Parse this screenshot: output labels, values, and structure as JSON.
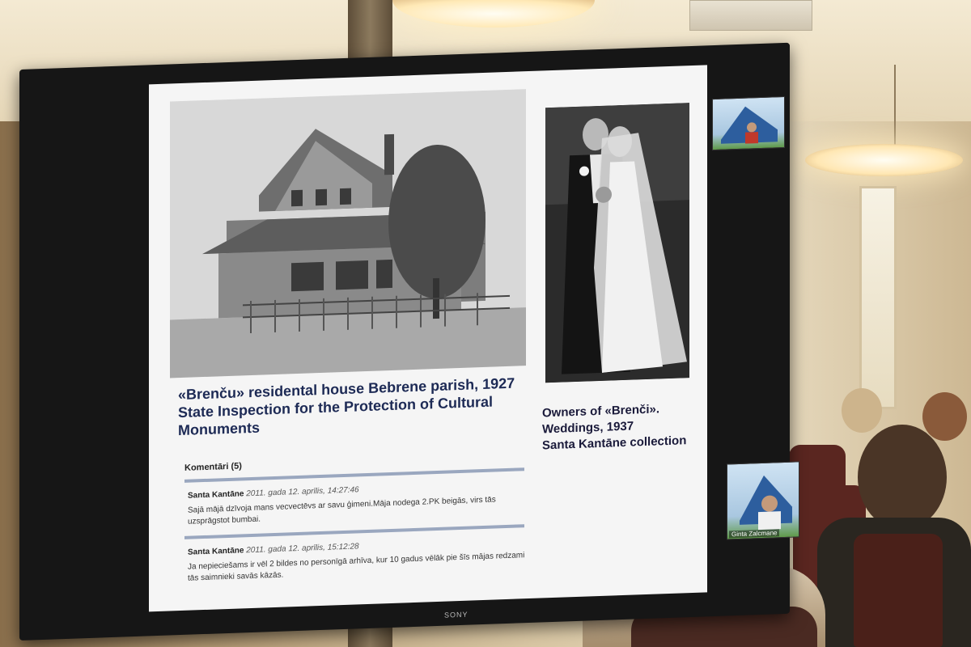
{
  "slide": {
    "caption_main": [
      "«Brenču» residental house Bebrene parish, 1927",
      "State Inspection for the Protection of Cultural",
      "Monuments"
    ],
    "caption_side": [
      "Owners of «Brenči».",
      "Weddings, 1937",
      "Santa Kantāne collection"
    ],
    "comments_header": "Komentāri (5)",
    "comments": [
      {
        "author": "Santa Kantāne",
        "date": "2011. gada 12. aprīlis, 14:27:46",
        "text": "Sajā mājā dzīvoja mans vecvectēvs ar savu ģimeni.Māja nodega 2.PK beigās, virs tās uzsprāgstot bumbai."
      },
      {
        "author": "Santa Kantāne",
        "date": "2011. gada 12. aprīlis, 15:12:28",
        "text": "Ja nepieciešams ir vēl 2 bildes no personīgā arhīva, kur 10 gadus vēlāk pie šīs mājas redzami tās saimnieki savās kāzās."
      }
    ]
  },
  "video": {
    "participant_name": "Ginta Zalcmane"
  },
  "tv": {
    "brand": "SONY"
  }
}
